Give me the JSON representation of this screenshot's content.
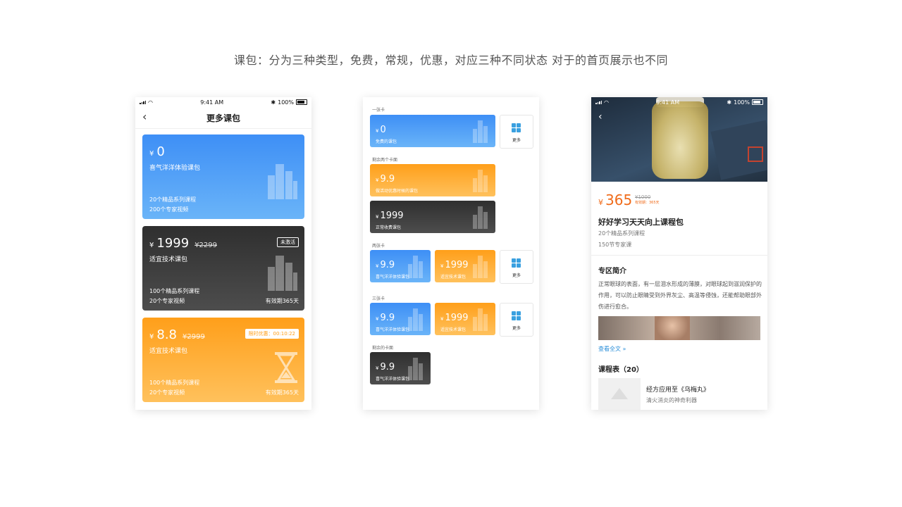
{
  "caption": "课包：分为三种类型，免费，常规，优惠，对应三种不同状态  对于的首页展示也不同",
  "status": {
    "time": "9:41 AM",
    "battery": "100%"
  },
  "phone1": {
    "title": "更多课包",
    "cards": [
      {
        "price": "0",
        "name": "喜气洋洋体验课包",
        "line1": "20个精品系列课程",
        "line2": "200个专家视频",
        "theme": "blue"
      },
      {
        "price": "1999",
        "orig": "¥2299",
        "name": "适宜技术课包",
        "badge": "未激活",
        "line1": "100个精品系列课程",
        "line2": "20个专家视频",
        "valid": "有效期365天",
        "theme": "dark"
      },
      {
        "price": "8.8",
        "orig": "¥2999",
        "name": "适宜技术课包",
        "badge": "限时优惠：00:10:22",
        "line1": "100个精品系列课程",
        "line2": "20个专家视频",
        "valid": "有效期365天",
        "theme": "orange"
      }
    ]
  },
  "phone2": {
    "sections": {
      "one": "一张卡",
      "rest2": "剩余两个卡面",
      "two": "两张卡",
      "three": "三张卡",
      "rest": "剩余的卡面"
    },
    "more_label": "更多",
    "cards": {
      "free": {
        "price": "0",
        "label": "免费的课包"
      },
      "promo": {
        "price": "9.9",
        "label": "做活动优惠时候的课包"
      },
      "normal": {
        "price": "1999",
        "label": "正常收费课包"
      },
      "two_a": {
        "price": "9.9",
        "label": "喜气洋洋体验课包"
      },
      "two_b": {
        "price": "1999",
        "label": "适宜技术课包"
      },
      "three_a": {
        "price": "9.9",
        "label": "喜气洋洋体验课包"
      },
      "three_b": {
        "price": "1999",
        "label": "适宜技术课包"
      },
      "rest_a": {
        "price": "9.9",
        "label": "喜气洋洋体验课包"
      }
    }
  },
  "phone3": {
    "price": "365",
    "orig": "¥1000",
    "validity": "有效期：365天",
    "title": "好好学习天天向上课程包",
    "sub1": "20个精品系列课程",
    "sub2": "150节专家课",
    "intro_title": "专区简介",
    "intro_text": "正常眼球的表面，有一层泪水形成的薄膜，对眼球起到滋润保护的作用，可以防止眼睛受到外界灰尘、高温等侵蚀，还能帮助眼部外伤进行愈合。",
    "read_more": "查看全文 »",
    "schedule_title": "课程表（20）",
    "course_title": "经方应用至《乌梅丸》",
    "course_sub": "清火消炎的神奇利器"
  },
  "yen": "¥",
  "colors": {
    "blue": "#3e8ff6",
    "dark": "#3a3a3a",
    "orange": "#ff9f1a",
    "price": "#f06b1a",
    "link": "#2b8fd9"
  }
}
